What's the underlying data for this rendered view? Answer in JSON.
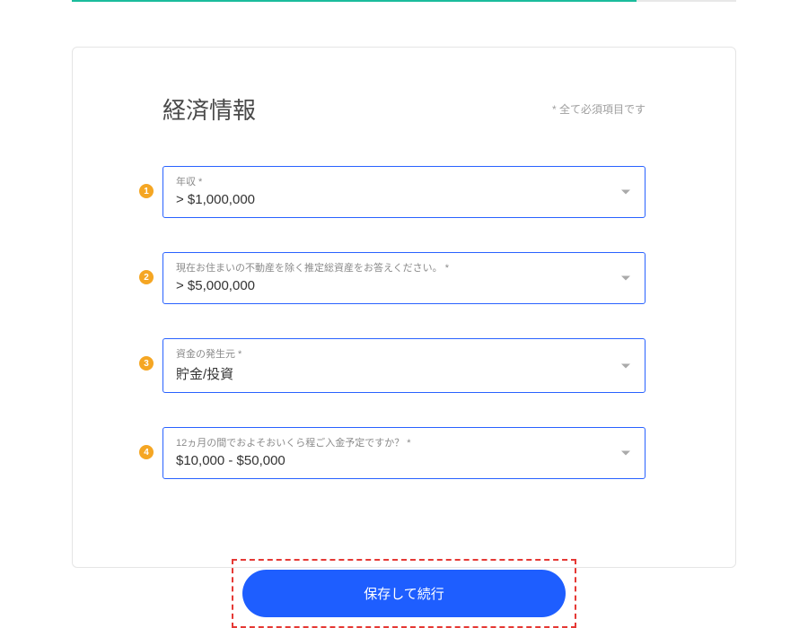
{
  "header": {
    "title": "経済情報",
    "required_note": "* 全て必須項目です"
  },
  "fields": [
    {
      "badge": "1",
      "label": "年収 *",
      "value": "> $1,000,000"
    },
    {
      "badge": "2",
      "label": "現在お住まいの不動産を除く推定総資産をお答えください。 *",
      "value": "> $5,000,000"
    },
    {
      "badge": "3",
      "label": "資金の発生元 *",
      "value": "貯金/投資"
    },
    {
      "badge": "4",
      "label": "12ヵ月の間でおよそおいくら程ご入金予定ですか？ *",
      "value": "$10,000 - $50,000"
    }
  ],
  "button": {
    "submit_label": "保存して続行"
  }
}
